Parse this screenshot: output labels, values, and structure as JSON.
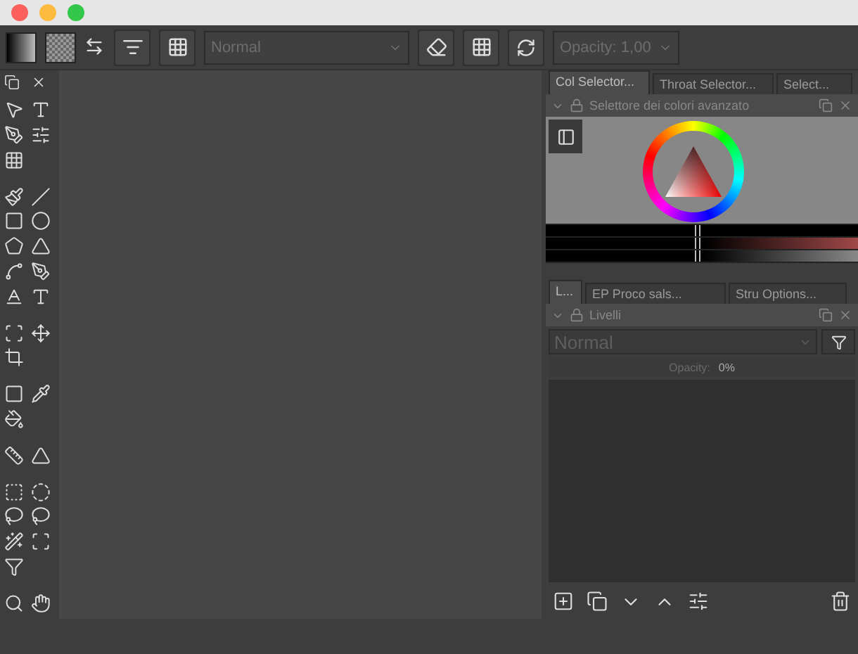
{
  "toolbar": {
    "blend_mode": "Normal",
    "opacity": "Opacity: 1,00"
  },
  "color_docker": {
    "tabs": [
      {
        "label": "Col Selector...",
        "selected": true
      },
      {
        "label": "Throat Selector...",
        "selected": false
      },
      {
        "label": "Select...",
        "selected": false
      }
    ],
    "title": "Selettore dei colori avanzato",
    "sliders": [
      {
        "level": 0.47
      },
      {
        "level": 0.47
      },
      {
        "level": 0.47
      }
    ]
  },
  "layers_docker": {
    "tabs": [
      {
        "label": "L...",
        "selected": true
      },
      {
        "label": "EP Proco sals...",
        "selected": false
      },
      {
        "label": "Stru Options...",
        "selected": false
      }
    ],
    "title": "Livelli",
    "blend_mode": "Normal",
    "opacity_label": "Opacity:",
    "opacity_value": "0%",
    "opacity_slider": {
      "level": 0
    }
  }
}
